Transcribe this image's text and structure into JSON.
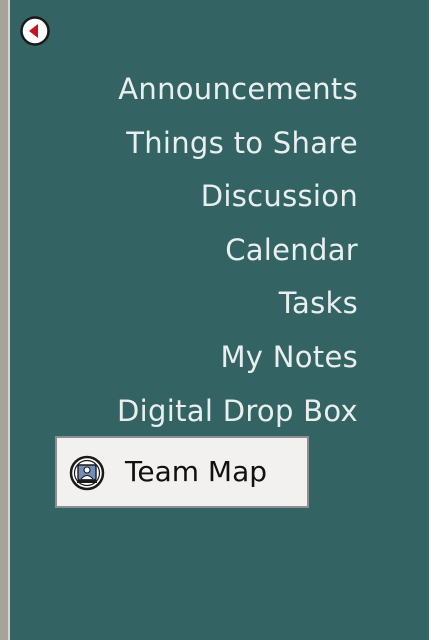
{
  "nav": {
    "back_icon": "back-arrow-icon",
    "items": [
      {
        "label": "Announcements"
      },
      {
        "label": "Things to Share"
      },
      {
        "label": "Discussion"
      },
      {
        "label": "Calendar"
      },
      {
        "label": "Tasks"
      },
      {
        "label": "My Notes"
      },
      {
        "label": "Digital Drop Box"
      }
    ]
  },
  "team_map": {
    "label": "Team Map",
    "icon": "team-map-icon"
  },
  "colors": {
    "panel": "#346363",
    "nav_text": "#e9efef",
    "button_face": "#f2f1ef",
    "back_arrow": "#c8141a"
  }
}
